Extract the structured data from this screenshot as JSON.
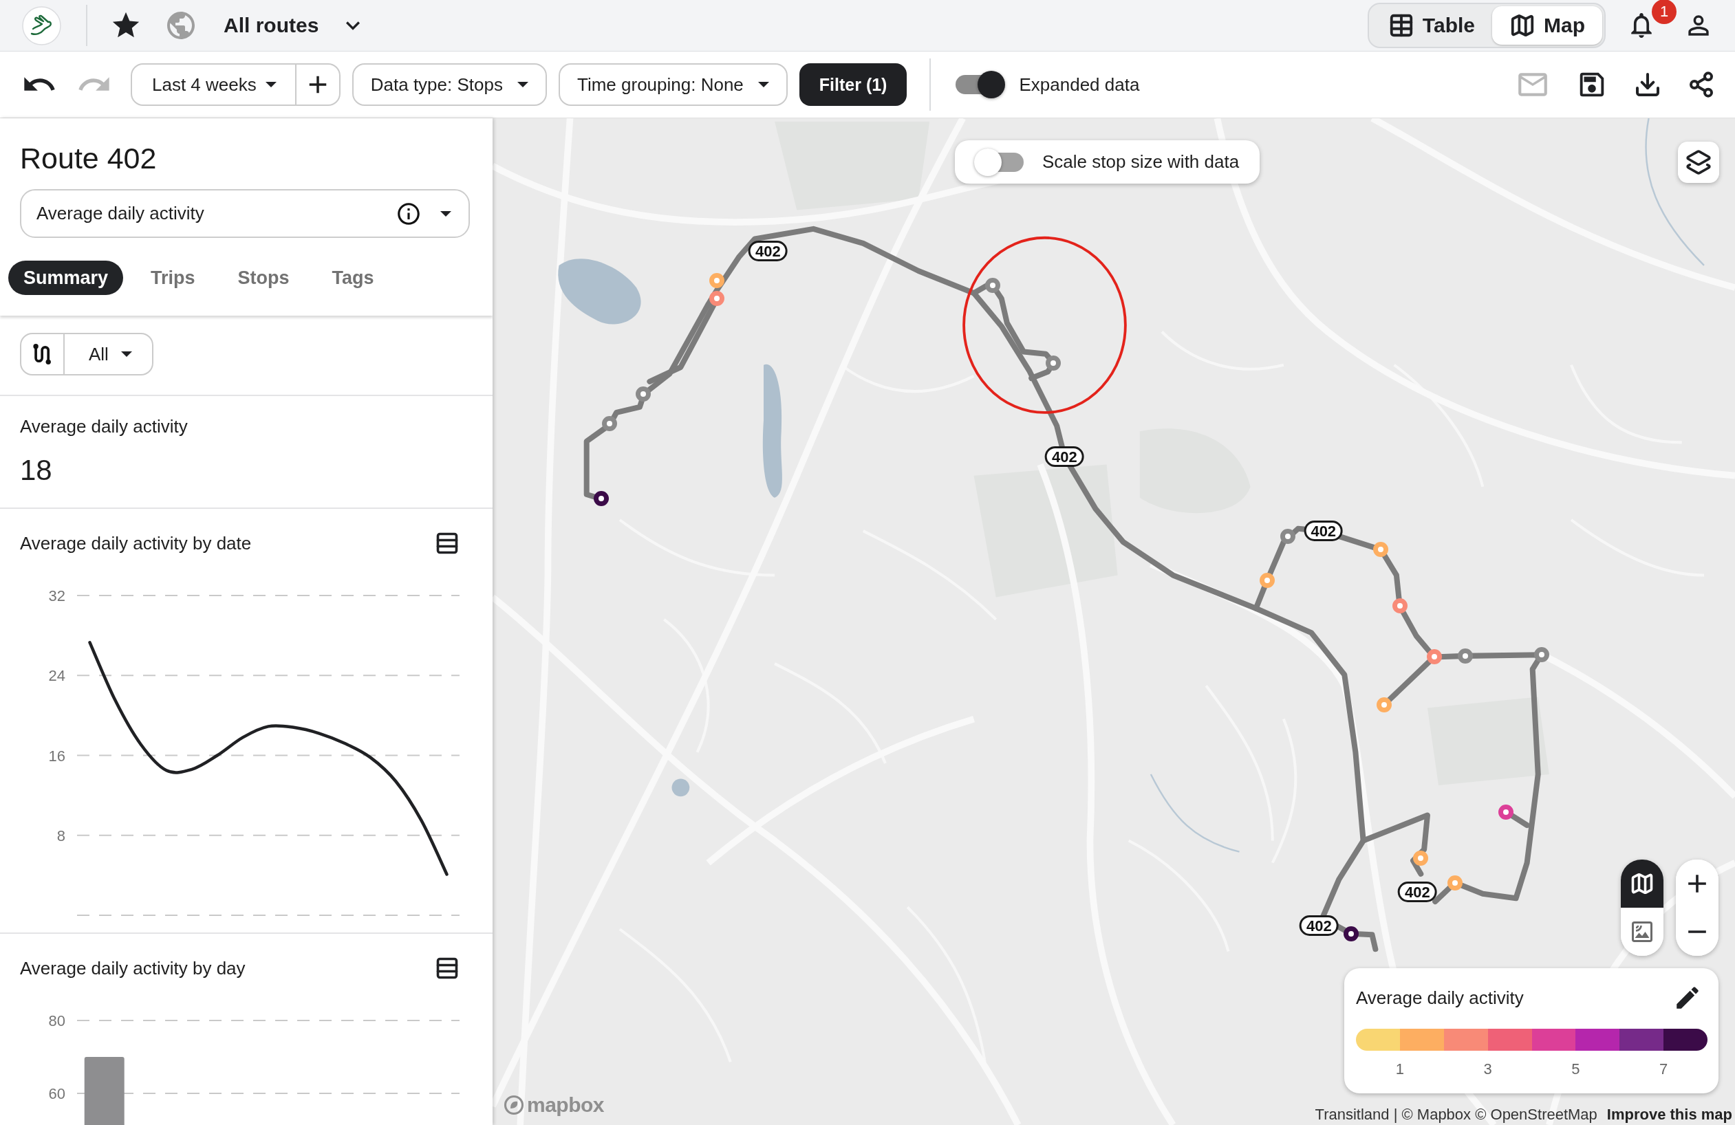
{
  "top_bar": {
    "title": "All routes",
    "views": [
      {
        "kind": "table",
        "label": "Table",
        "selected": false
      },
      {
        "kind": "map",
        "label": "Map",
        "selected": true
      }
    ],
    "notifications": "1"
  },
  "toolbar": {
    "history": [
      {
        "kind": "undo",
        "disabled": false
      },
      {
        "kind": "redo",
        "disabled": true
      }
    ],
    "date_range": "Last 4 weeks",
    "selects": [
      "Data type: Stops",
      "Time grouping: None"
    ],
    "filter": "Filter (1)",
    "expanded_data": {
      "label": "Expanded data",
      "on": true
    },
    "actions": [
      {
        "kind": "email",
        "disabled": true
      },
      {
        "kind": "save",
        "disabled": false
      },
      {
        "kind": "download",
        "disabled": false
      },
      {
        "kind": "share",
        "disabled": false
      }
    ]
  },
  "panel": {
    "title": "Route 402",
    "metric": "Average daily activity",
    "tabs": [
      {
        "label": "Summary",
        "selected": true
      },
      {
        "label": "Trips",
        "selected": false
      },
      {
        "label": "Stops",
        "selected": false
      },
      {
        "label": "Tags",
        "selected": false
      }
    ],
    "direction": "All",
    "stat": {
      "label": "Average daily activity",
      "value": "18"
    },
    "charts": [
      {
        "chart_data": {
          "type": "line",
          "title": "Average daily activity by date",
          "ylim": [
            0,
            32
          ],
          "yticks": [
            8,
            16,
            24,
            32
          ],
          "grid": true,
          "series": [
            {
              "color": "#202124",
              "values": [
                27.3,
                21.5,
                17.1,
                14.5,
                14.6,
                16.0,
                17.8,
                18.9,
                18.8,
                18.2,
                17.2,
                15.8,
                13.4,
                9.5,
                4.1
              ]
            }
          ]
        }
      },
      {
        "chart_data": {
          "type": "bar",
          "title": "Average daily activity by day",
          "ylim": [
            0,
            80
          ],
          "yticks": [
            60,
            80
          ],
          "grid": true,
          "values": [
            70,
            null,
            null,
            null,
            null,
            null,
            null
          ]
        }
      }
    ]
  },
  "map": {
    "scale_stops": {
      "label": "Scale stop size with data",
      "on": false
    },
    "styles": [
      {
        "kind": "map",
        "selected": true
      },
      {
        "kind": "satellite",
        "selected": false
      }
    ],
    "route_shields": [
      "402",
      "402",
      "402",
      "402",
      "402"
    ],
    "stops": [
      {
        "color": "#fdae61"
      },
      {
        "color": "#f88a77"
      },
      {
        "color": "#8a8a8a"
      },
      {
        "color": "#8a8a8a"
      },
      {
        "color": "#3b0b48"
      },
      {
        "color": "#8a8a8a"
      },
      {
        "color": "#8a8a8a"
      },
      {
        "color": "#8a8a8a"
      },
      {
        "color": "#fdae61"
      },
      {
        "color": "#fdae61"
      },
      {
        "color": "#f88a77"
      },
      {
        "color": "#f88a77"
      },
      {
        "color": "#8a8a8a"
      },
      {
        "color": "#8a8a8a"
      },
      {
        "color": "#fdae61"
      },
      {
        "color": "#dc3f98"
      },
      {
        "color": "#fdae61"
      },
      {
        "color": "#fdae61"
      },
      {
        "color": "#3b0b48"
      }
    ],
    "legend": {
      "title": "Average daily activity",
      "swatches": [
        {
          "color": "#f9d672"
        },
        {
          "color": "#fdae61"
        },
        {
          "color": "#f88a77"
        },
        {
          "color": "#ef6177"
        },
        {
          "color": "#dc3f98"
        },
        {
          "color": "#b526ac"
        },
        {
          "color": "#762a89"
        },
        {
          "color": "#3b0b48"
        }
      ],
      "ticks": [
        "1",
        "3",
        "5",
        "7"
      ]
    },
    "attribution": {
      "text": "Transitland | © Mapbox © OpenStreetMap",
      "link": "Improve this map"
    },
    "logo": "mapbox"
  }
}
